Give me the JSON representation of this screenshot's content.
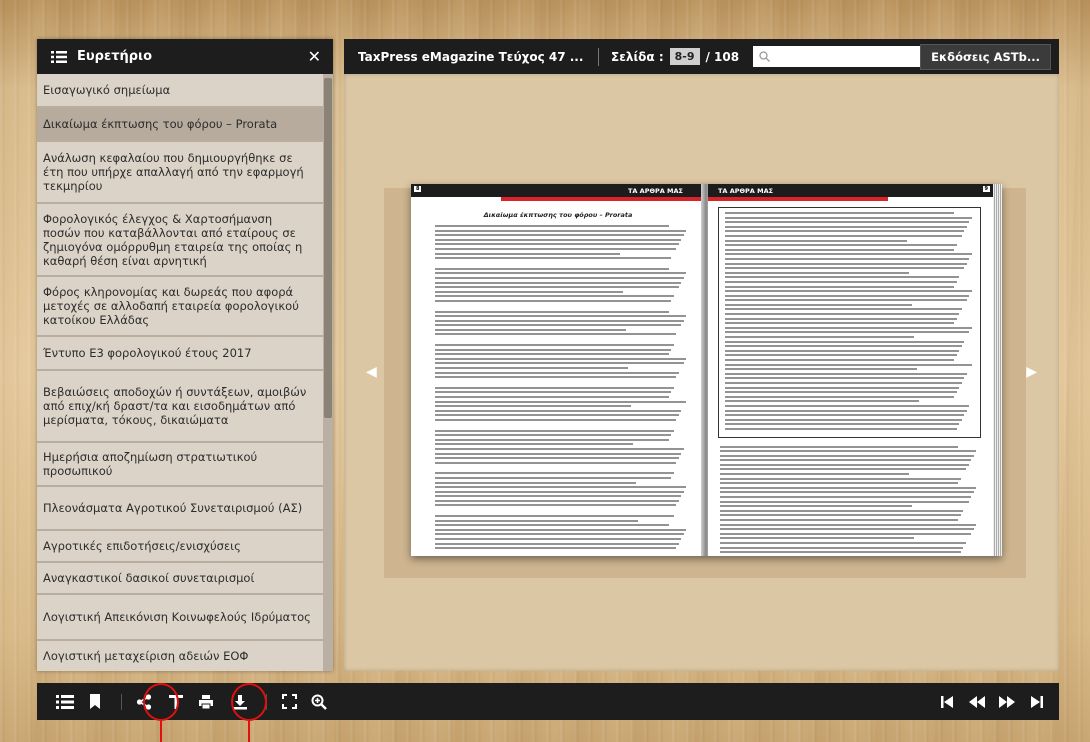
{
  "sidebar": {
    "title": "Ευρετήριο",
    "close_label": "✕",
    "items": [
      {
        "label": "Εισαγωγικό σημείωμα",
        "active": false
      },
      {
        "label": "Δικαίωμα έκπτωσης του φόρου – Prorata",
        "active": true
      },
      {
        "label": "Ανάλωση κεφαλαίου που δημιουργήθηκε σε έτη που υπήρχε απαλλαγή  από την εφαρμογή τεκμηρίου",
        "active": false
      },
      {
        "label": "Φορολογικός έλεγχος & Χαρτοσήμανση ποσών που καταβάλλονται από  εταίρους σε ζημιογόνα ομόρρυθμη εταιρεία της οποίας η καθαρή θέση είναι αρνητική",
        "active": false
      },
      {
        "label": "Φόρος κληρονομίας και δωρεάς που αφορά μετοχές σε αλλοδαπή εταιρεία φορολογικού κατοίκου Ελλάδας",
        "active": false
      },
      {
        "label": "Έντυπο Ε3 φορολογικού έτους 2017",
        "active": false
      },
      {
        "label": "Βεβαιώσεις αποδοχών ή συντάξεων, αμοιβών από επιχ/κή δραστ/τα και εισοδημάτων από μερίσματα, τόκους, δικαιώματα",
        "active": false
      },
      {
        "label": "Ημερήσια αποζημίωση στρατιωτικού προσωπικού",
        "active": false
      },
      {
        "label": "Πλεονάσματα Αγροτικού Συνεταιρισμού (ΑΣ)",
        "active": false
      },
      {
        "label": "Αγροτικές επιδοτήσεις/ενισχύσεις",
        "active": false
      },
      {
        "label": "Αναγκαστικοί δασικοί συνεταιρισμοί",
        "active": false
      },
      {
        "label": "Λογιστική Απεικόνιση Κοινωφελούς Ιδρύματος",
        "active": false
      },
      {
        "label": "Λογιστική μεταχείριση αδειών ΕΟΦ",
        "active": false
      }
    ]
  },
  "topbar": {
    "magazine_title": "TaxPress eMagazine Τεύχος 47 ...",
    "page_label": "Σελίδα :",
    "current_pages": "8-9",
    "total_pages": "/ 108",
    "search_placeholder": "",
    "editions_label": "Εκδόσεις ASTb..."
  },
  "book": {
    "left_header": "ΤΑ ΑΡΘΡΑ ΜΑΣ",
    "right_header": "ΤΑ ΑΡΘΡΑ ΜΑΣ",
    "left_page_number": "8",
    "right_page_number": "9",
    "article_title": "Δικαίωμα έκπτωσης του φόρου – Prorata"
  },
  "toolbar": {
    "icons": [
      "table-of-contents-icon",
      "bookmark-icon",
      "share-icon",
      "text-icon",
      "print-icon",
      "download-icon",
      "fullscreen-icon",
      "zoom-icon",
      "first-page-icon",
      "previous-page-icon",
      "next-page-icon",
      "last-page-icon"
    ]
  },
  "colors": {
    "bar_bg": "#1d1d1d",
    "accent_red": "#d8232a",
    "annotation_red": "#e01010",
    "sidebar_item_bg": "#dbd3c7",
    "sidebar_active_bg": "#b6ab9c"
  }
}
